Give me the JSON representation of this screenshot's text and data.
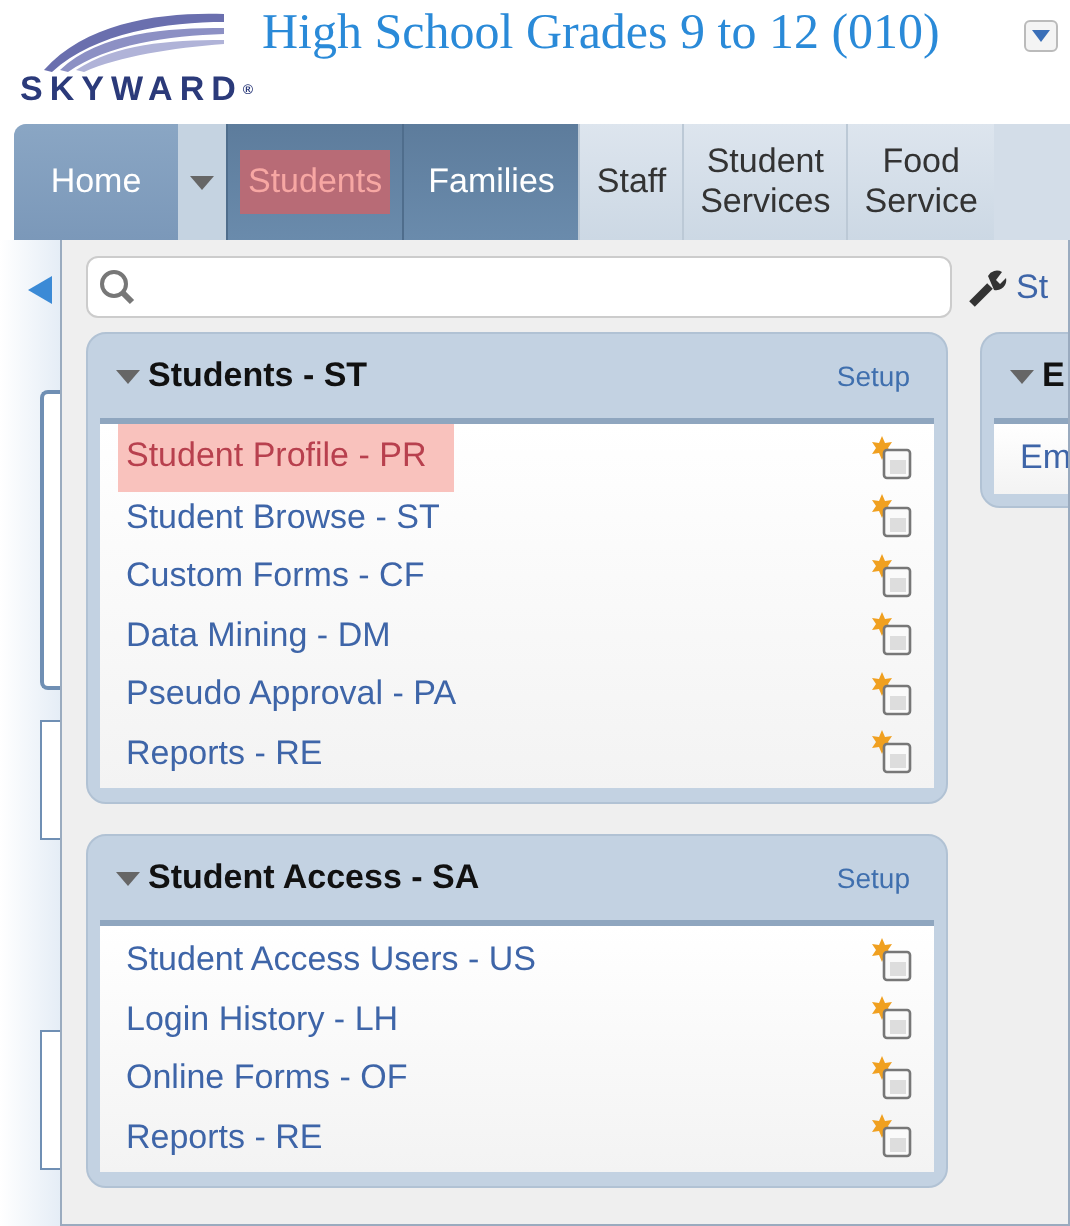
{
  "header": {
    "logo": "SKYWARD$^{®}$",
    "title": "High School Grades 9 to 12 (010)"
  },
  "tabs": [
    {
      "label": "Home",
      "kind": "home",
      "selected": false
    },
    {
      "label": "Students",
      "kind": "module",
      "selected": true
    },
    {
      "label": "Families",
      "kind": "module",
      "selected": false
    },
    {
      "label": "Staff",
      "kind": "other",
      "selected": false
    },
    {
      "label": "Student\nServices",
      "kind": "other",
      "selected": false
    },
    {
      "label": "Food\nService",
      "kind": "other",
      "selected": false
    }
  ],
  "side_link": "St",
  "cards": [
    {
      "title": "Students - ST",
      "setup": "Setup",
      "items": [
        {
          "label": "Student Profile - PR",
          "highlighted": true
        },
        {
          "label": "Student Browse - ST",
          "highlighted": false
        },
        {
          "label": "Custom Forms - CF",
          "highlighted": false
        },
        {
          "label": "Data Mining - DM",
          "highlighted": false
        },
        {
          "label": "Pseudo Approval - PA",
          "highlighted": false
        },
        {
          "label": "Reports - RE",
          "highlighted": false
        }
      ]
    },
    {
      "title": "Student Access - SA",
      "setup": "Setup",
      "items": [
        {
          "label": "Student Access Users - US",
          "highlighted": false
        },
        {
          "label": "Login History - LH",
          "highlighted": false
        },
        {
          "label": "Online Forms - OF",
          "highlighted": false
        },
        {
          "label": "Reports - RE",
          "highlighted": false
        }
      ]
    }
  ],
  "side_card": {
    "title": "E",
    "items": [
      "Em"
    ]
  }
}
